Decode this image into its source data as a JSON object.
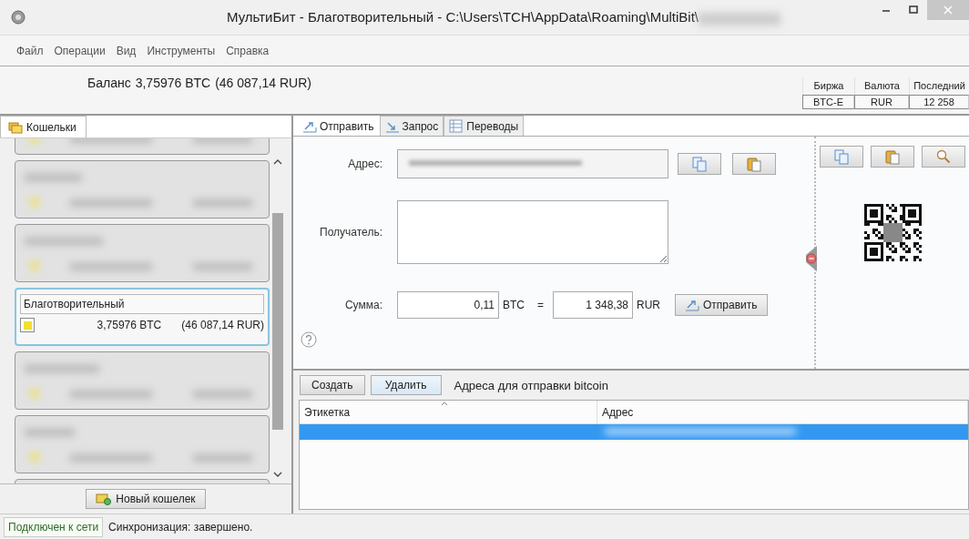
{
  "window": {
    "title": "МультиБит - Благотворительный - C:\\Users\\TCH\\AppData\\Roaming\\MultiBit\\"
  },
  "menu": [
    "Файл",
    "Операции",
    "Вид",
    "Инструменты",
    "Справка"
  ],
  "balance": {
    "label": "Баланс",
    "btc": "3,75976 BTC",
    "fiat": "(46 087,14 RUR)"
  },
  "ticker": {
    "columns": [
      "Биржа",
      "Валюта",
      "Последний"
    ],
    "values": [
      "BTC-E",
      "RUR",
      "12 258"
    ]
  },
  "wallets_tab": {
    "label": "Кошельки"
  },
  "wallets": [
    {
      "kind": "obscured",
      "selected": false
    },
    {
      "kind": "obscured",
      "selected": false
    },
    {
      "kind": "obscured",
      "selected": false
    },
    {
      "kind": "wallet",
      "name": "Благотворительный",
      "btc": "3,75976 BTC",
      "fiat": "(46 087,14 RUR)",
      "selected": true
    },
    {
      "kind": "obscured",
      "selected": false
    },
    {
      "kind": "obscured",
      "selected": false
    },
    {
      "kind": "obscured",
      "selected": false
    }
  ],
  "new_wallet_button": "Новый кошелек",
  "tabs": [
    {
      "label": "Отправить",
      "selected": true
    },
    {
      "label": "Запрос",
      "selected": false
    },
    {
      "label": "Переводы",
      "selected": false
    }
  ],
  "send_form": {
    "address_label": "Адрес:",
    "recipient_label": "Получатель:",
    "amount_label": "Сумма:",
    "btc_amount": "0,11",
    "btc_unit": "BTC",
    "equals": "=",
    "fiat_amount": "1 348,38",
    "fiat_unit": "RUR",
    "send_button": "Отправить"
  },
  "address_book": {
    "buttons": [
      "Создать",
      "Удалить"
    ],
    "title": "Адреса для отправки bitcoin",
    "columns": [
      "Этикетка",
      "Адрес"
    ],
    "rows": [
      {
        "selected": true
      }
    ]
  },
  "status_bar": {
    "connection": "Подключен к сети",
    "sync": "Синхронизация: завершено."
  }
}
